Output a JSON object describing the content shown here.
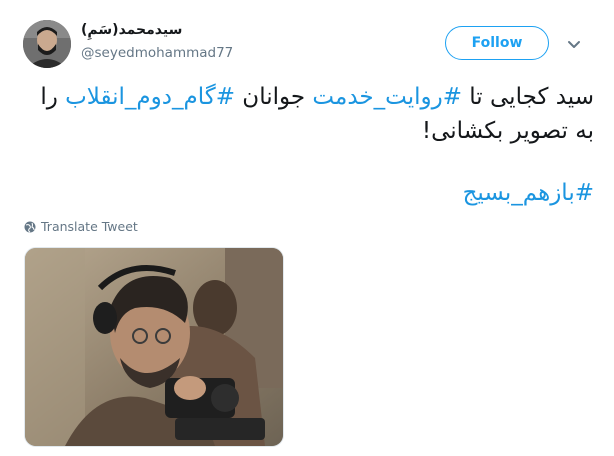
{
  "user": {
    "name": "(سَمِ)سیدمحمد",
    "handle": "@seyedmohammad77"
  },
  "follow_label": "Follow",
  "tweet": {
    "segments": [
      {
        "text": "سید کجایی تا ",
        "tag": false
      },
      {
        "text": "#روایت_خدمت",
        "tag": true
      },
      {
        "text": " جوانان ",
        "tag": false
      },
      {
        "text": "#گام_دوم_انقلاب",
        "tag": true
      },
      {
        "text": " را به تصویر بکشانی!",
        "tag": false
      }
    ],
    "hashtag": "#بازهم_بسیج"
  },
  "translate_label": "Translate Tweet",
  "icons": {
    "globe": "globe-icon",
    "chevron": "chevron-down-icon"
  },
  "colors": {
    "accent": "#1da1f2",
    "link": "#1b95e0",
    "muted": "#657786"
  }
}
